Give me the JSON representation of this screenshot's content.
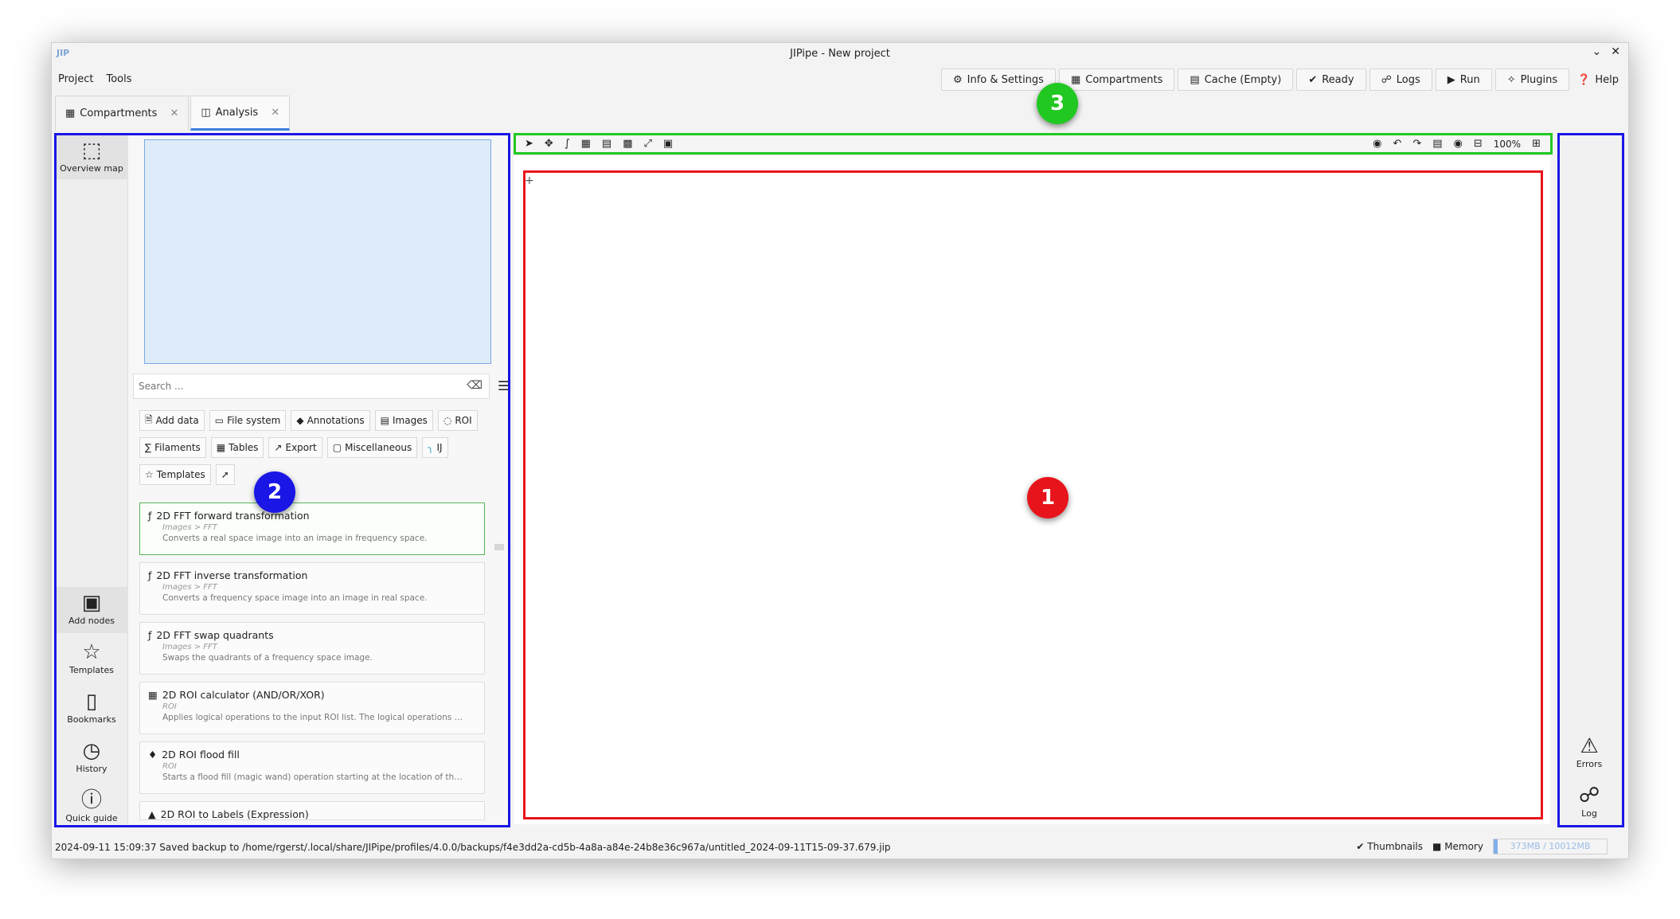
{
  "window": {
    "title": "JIPipe - New project",
    "logo": "JIP"
  },
  "menubar": {
    "items": [
      "Project",
      "Tools"
    ]
  },
  "toolbar": {
    "info_settings": "Info & Settings",
    "compartments": "Compartments",
    "cache": "Cache (Empty)",
    "ready": "Ready",
    "logs": "Logs",
    "run": "Run",
    "plugins": "Plugins",
    "help": "Help"
  },
  "tabs": [
    {
      "label": "Compartments"
    },
    {
      "label": "Analysis"
    }
  ],
  "leftbar": {
    "overview_map": "Overview map",
    "add_nodes": "Add nodes",
    "templates": "Templates",
    "bookmarks": "Bookmarks",
    "history": "History",
    "quick_guide": "Quick guide"
  },
  "search": {
    "placeholder": "Search ..."
  },
  "categories": [
    "Add data",
    "File system",
    "Annotations",
    "Images",
    "ROI",
    "Filaments",
    "Tables",
    "Export",
    "Miscellaneous",
    "IJ",
    "Templates"
  ],
  "nodes": [
    {
      "name": "2D FFT forward transformation",
      "path": "Images > FFT",
      "desc": "Converts a real space image into an image in frequency space."
    },
    {
      "name": "2D FFT inverse transformation",
      "path": "Images > FFT",
      "desc": "Converts a frequency space image into an image in real space."
    },
    {
      "name": "2D FFT swap quadrants",
      "path": "Images > FFT",
      "desc": "Swaps the quadrants of a frequency space image."
    },
    {
      "name": "2D ROI calculator (AND/OR/XOR)",
      "path": "ROI",
      "desc": "Applies logical operations to the input ROI list. The logical operations are applie..."
    },
    {
      "name": "2D ROI flood fill",
      "path": "ROI",
      "desc": "Starts a flood fill (magic wand) operation starting at the location of the ROI. Mult..."
    },
    {
      "name": "2D ROI to Labels (Expression)",
      "path": "",
      "desc": ""
    }
  ],
  "canvas": {
    "zoom": "100%"
  },
  "rightbar": {
    "errors": "Errors",
    "log": "Log"
  },
  "status": {
    "message": "2024-09-11 15:09:37 Saved backup to /home/rgerst/.local/share/JIPipe/profiles/4.0.0/backups/f4e3dd2a-cd5b-4a8a-a84e-24b8e36c967a/untitled_2024-09-11T15-09-37.679.jip",
    "thumbnails": "Thumbnails",
    "memory": "Memory",
    "memory_usage": "373MB / 10012MB",
    "memory_fraction": 0.037
  },
  "annotations": [
    {
      "number": "1",
      "color": "#e8141b"
    },
    {
      "number": "2",
      "color": "#1a16e6"
    },
    {
      "number": "3",
      "color": "#22c822"
    }
  ]
}
